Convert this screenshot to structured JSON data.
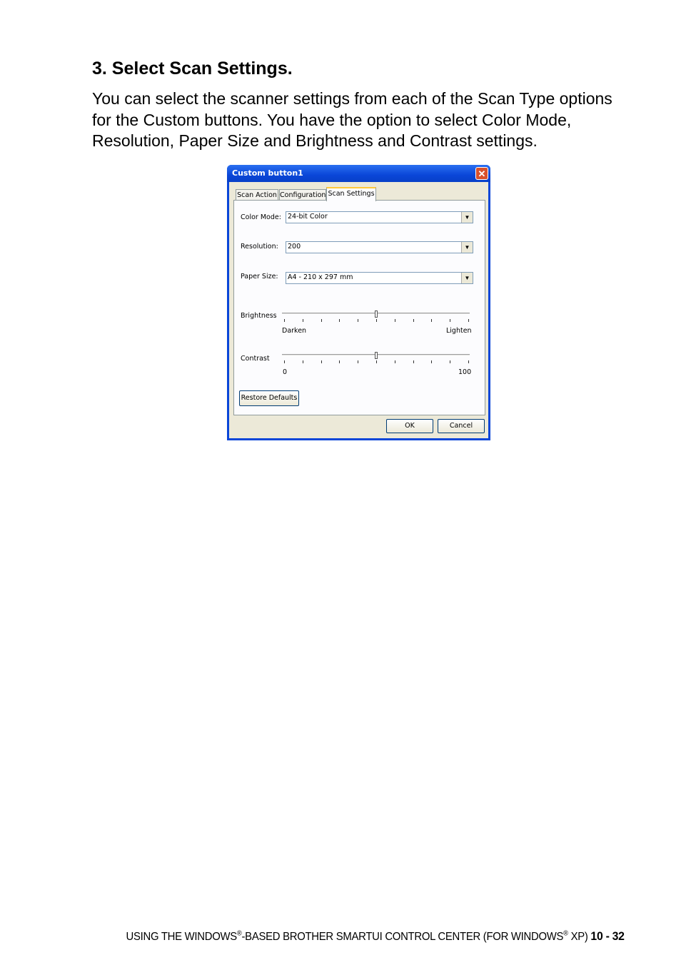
{
  "doc": {
    "heading": "3. Select Scan Settings.",
    "intro": "You can select the scanner settings from each of the Scan Type options for the Custom buttons. You have the option to select Color Mode, Resolution, Paper Size and Brightness and Contrast settings."
  },
  "dialog": {
    "title": "Custom button1",
    "close_glyph": "✕",
    "tabs": [
      "Scan Action",
      "Configuration",
      "Scan Settings"
    ],
    "active_tab": "Scan Settings",
    "color_mode": {
      "label": "Color Mode:",
      "value": "24-bit Color"
    },
    "resolution": {
      "label": "Resolution:",
      "value": "200"
    },
    "paper_size": {
      "label": "Paper Size:",
      "value": "A4 - 210 x 297 mm"
    },
    "dropdown_arrow": "▼",
    "brightness": {
      "label": "Brightness",
      "min_label": "Darken",
      "max_label": "Lighten",
      "level_percent": 50
    },
    "contrast": {
      "label": "Contrast",
      "min_label": "0",
      "max_label": "100",
      "level_percent": 50
    },
    "restore_defaults": "Restore Defaults",
    "ok": "OK",
    "cancel": "Cancel"
  },
  "footer": {
    "text_a": "USING THE WINDOWS",
    "reg1": "®",
    "text_b": "-BASED BROTHER SMARTUI CONTROL CENTER (FOR WINDOWS",
    "reg2": "®",
    "text_c": " XP) ",
    "page": "10 - 32"
  },
  "colors": {
    "titlebar": "#0a46d8",
    "dialog_bg": "#ece9d8",
    "tab_highlight": "#ffc83c",
    "close_button": "#d9512c"
  }
}
